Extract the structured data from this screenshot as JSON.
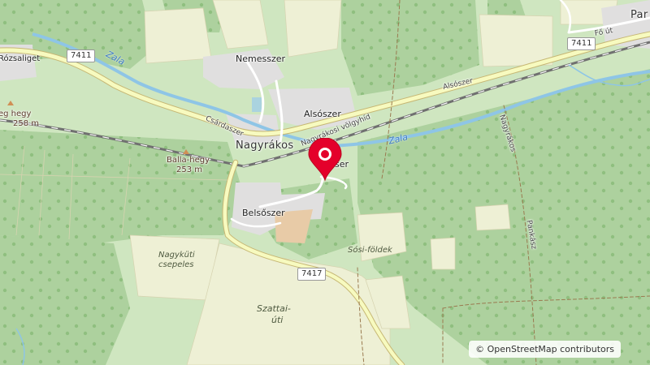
{
  "map": {
    "places": {
      "nagyrakos": "Nagyrákos",
      "nemesszer": "Nemesszer",
      "alsoszer": "Alsószer",
      "belsoszer": "Belsőszer",
      "pityerszer_partial": "ser",
      "csardaszer": "Csárdaszer",
      "parti_partial": "Par",
      "rozsaliget_partial": "Rózsaliget"
    },
    "streets": {
      "alsoszer": "Alsószer",
      "nagyrakosi_volgyhid": "Nagyrákosi völgyhíd",
      "fo_ut": "Fő út",
      "nagyrakos_road": "Nagyrákos",
      "pankasz_road": "Pankász"
    },
    "rivers": {
      "zala_west": "Zala",
      "zala_east": "Zala"
    },
    "peaks": {
      "balla_hegy": "Balla-hegy",
      "balla_hegy_elev": "253 m",
      "hegy_west": "eg hegy",
      "hegy_west_elev": "258 m"
    },
    "fields": {
      "nagykuti_csepeles_1": "Nagyküti",
      "nagykuti_csepeles_2": "csepeles",
      "sosi_foldek": "Sósi-földek",
      "szattai_uti_1": "Szattai-",
      "szattai_uti_2": "úti"
    },
    "road_refs": {
      "r7411_west": "7411",
      "r7411_east": "7411",
      "r7417": "7417"
    },
    "colors": {
      "forest": "#add19e",
      "meadow": "#cfe6c0",
      "farmland": "#eef0d5",
      "residential": "#e0dfdf",
      "water": "#aad3df",
      "river": "#8ec5e6",
      "road_yellow": "#f7fabf",
      "road_casing": "#c6b774",
      "rail": "#707070",
      "marker": "#e4002b"
    },
    "marker_icon": "location-pin-icon"
  },
  "attribution": {
    "symbol": "©",
    "text": "OpenStreetMap contributors"
  }
}
